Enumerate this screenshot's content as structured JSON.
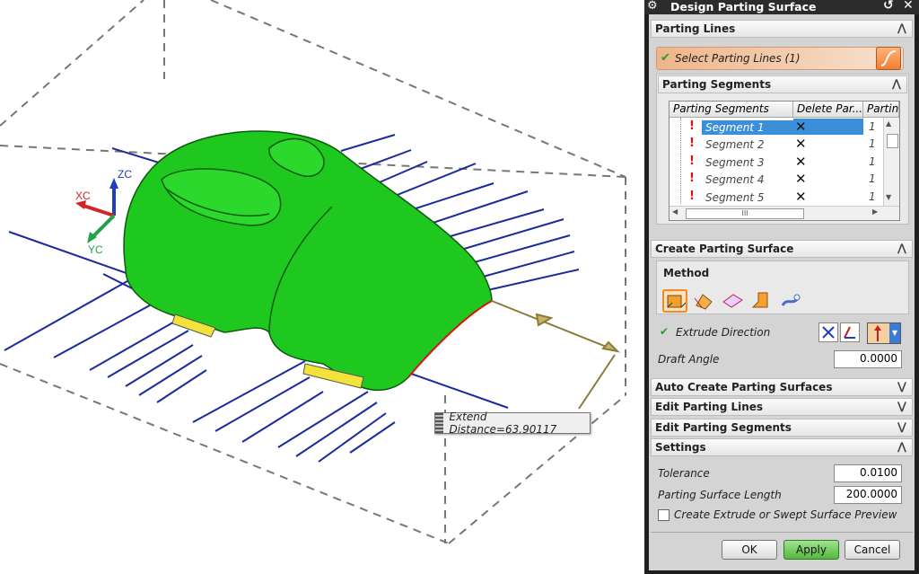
{
  "viewport": {
    "axes": {
      "x": "XC",
      "y": "YC",
      "z": "ZC"
    },
    "extend_label": "Extend Distance=63.90117"
  },
  "dialog": {
    "title": "Design Parting Surface",
    "sections": {
      "parting_lines": "Parting Lines",
      "create_surface": "Create Parting Surface",
      "auto_create": "Auto Create Parting Surfaces",
      "edit_lines": "Edit Parting Lines",
      "edit_segments": "Edit Parting Segments",
      "settings": "Settings"
    },
    "select_parting_lines": "Select Parting Lines (1)",
    "parting_segments": {
      "title": "Parting Segments",
      "columns": [
        "Parting Segments",
        "Delete Par...",
        "Partin"
      ],
      "rows": [
        {
          "name": "Segment 1",
          "value": "1"
        },
        {
          "name": "Segment 2",
          "value": "1"
        },
        {
          "name": "Segment 3",
          "value": "1"
        },
        {
          "name": "Segment 4",
          "value": "1"
        },
        {
          "name": "Segment 5",
          "value": "1"
        }
      ],
      "scroll_mark": "III"
    },
    "method": {
      "title": "Method",
      "buttons": [
        "extrude-method",
        "swept-method",
        "bounded-plane-method",
        "extended-surface-method",
        "offset-method"
      ]
    },
    "extrude_direction": "Extrude Direction",
    "draft_angle": {
      "label": "Draft Angle",
      "value": "0.0000"
    },
    "tolerance": {
      "label": "Tolerance",
      "value": "0.0100"
    },
    "parting_surface_length": {
      "label": "Parting Surface Length",
      "value": "200.0000"
    },
    "preview_checkbox": "Create Extrude or Swept Surface Preview",
    "buttons": {
      "ok": "OK",
      "apply": "Apply",
      "cancel": "Cancel"
    },
    "colors": {
      "accent_green": "#22a34a",
      "selection_blue": "#3b8fd9",
      "select_row_orange": "#efb58a"
    }
  }
}
